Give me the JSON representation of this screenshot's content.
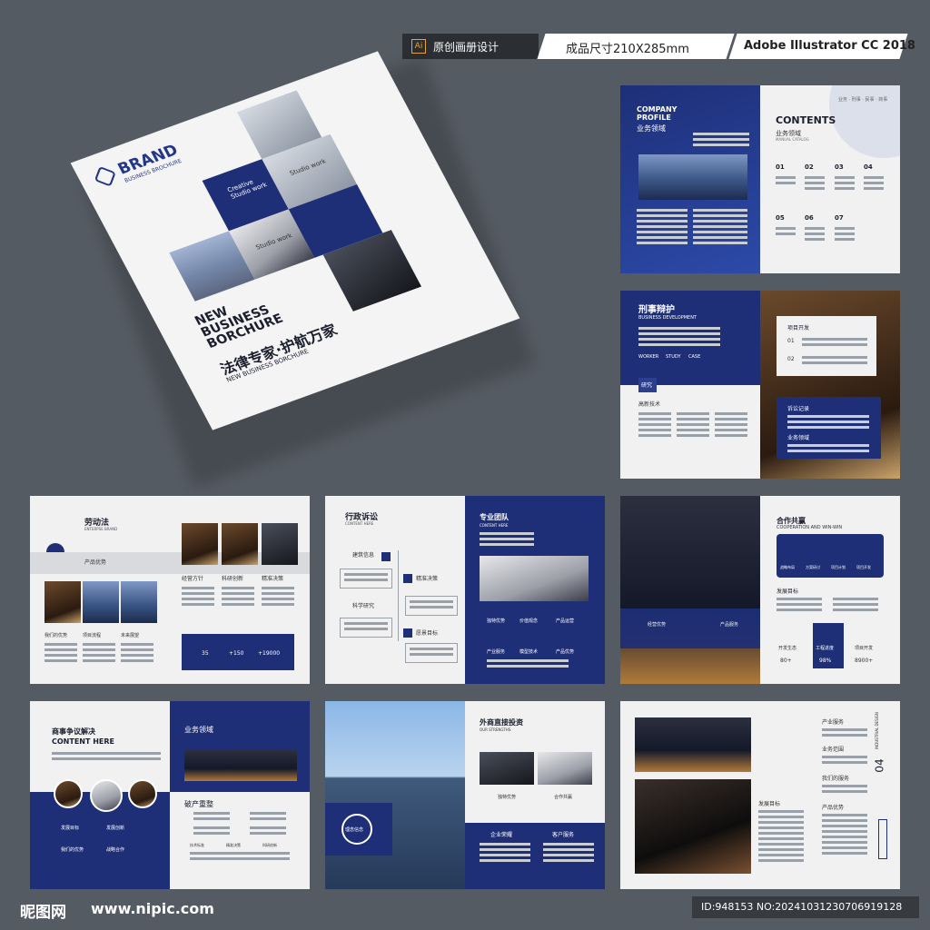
{
  "top_bar": {
    "ai_badge": "Ai",
    "design_label": "原创画册设计",
    "size_label": "成品尺寸210X285mm",
    "software_label": "Adobe Illustrator CC 2018"
  },
  "cover": {
    "brand": "BRAND",
    "brand_sub": "BUSINESS BROCHURE",
    "tile1_title": "Creative Studio work",
    "tile2_title": "Studio work",
    "tile3_title": "Studio work",
    "headline_en": "NEW\nBUSINESS\nBORCHURE",
    "headline_cn": "法律专家·护航万家",
    "headline_sub": "NEW BUSINESS BORCHURE"
  },
  "page_contents": {
    "company_profile": "COMPANY\nPROFILE",
    "profile_cn": "业务领域",
    "contents": "CONTENTS",
    "contents_sub": "业务领域",
    "manual_catalog": "MANUAL CATALOG",
    "nums": [
      "01",
      "02",
      "03",
      "04",
      "05",
      "06",
      "07"
    ],
    "corner_text": "业务 · 刑事 · 民事 · 商事"
  },
  "page_criminal": {
    "title": "刑事辩护",
    "subtitle": "BUSINESS DEVELOPMENT",
    "tabs": [
      "WORKER",
      "STUDY",
      "CASE"
    ],
    "research": "研究",
    "skill": "高新技术",
    "project": "项目开发",
    "n1": "01",
    "n2": "02",
    "record": "诉讼记录",
    "field": "业务领域"
  },
  "page_labor": {
    "title": "劳动法",
    "subtitle": "ENTERPSE BRAND",
    "product": "产品优势",
    "c1": "经营方针",
    "c2": "科研创新",
    "c3": "精准决策",
    "b1": "我们的优势",
    "b2": "项目流程",
    "b3": "未来展望",
    "s1": "35",
    "s2": "+150",
    "s3": "+19000"
  },
  "page_admin": {
    "title": "行政诉讼",
    "subtitle": "CONTENT HERE",
    "t1": "建筑信息",
    "t2": "科学研究",
    "t3": "精准决策",
    "t4": "愿景目标",
    "team": "专业团队",
    "team_sub": "CONTENT HERE",
    "i1": "独特优势",
    "i2": "价值观念",
    "i3": "产品运营",
    "i4": "产业服务",
    "i5": "模型技术",
    "i6": "产品优势"
  },
  "page_coop": {
    "title": "合作共赢",
    "subtitle": "COOPERATION AND WIN-WIN",
    "h1": "战略布局",
    "h2": "方案研讨",
    "h3": "项目计划",
    "h4": "项目开发",
    "goal": "发展目标",
    "n1": "经营优势",
    "n2": "产品服务",
    "s1": "开发生态",
    "s2": "工程进度",
    "s3": "项目开发",
    "v1": "80+",
    "v2": "98%",
    "v3": "8900+"
  },
  "page_commercial": {
    "title": "商事争议解决",
    "subtitle": "CONTENT HERE",
    "field": "业务领域",
    "bankruptcy": "破产重整",
    "g1": "发展目标",
    "g2": "发展创新",
    "g3": "我们的优势",
    "g4": "战略合作",
    "q1": "技术标准",
    "q2": "精准决策",
    "q3": "科研创新"
  },
  "page_foreign": {
    "title": "外商直接投资",
    "subtitle": "OUR STRENGTHS",
    "c1": "独特优势",
    "c2": "合作共赢",
    "circle": "理念信念",
    "b1": "企业荣耀",
    "b2": "客户服务"
  },
  "page_last": {
    "l1": "产业服务",
    "l2": "业务范围",
    "l3": "我们的服务",
    "l4": "产品优势",
    "goal": "发展目标",
    "side_num": "04",
    "side_text": "INDUSTRIAL DESIGN"
  },
  "footer": {
    "logo": "昵图网",
    "url": "www.nipic.com",
    "id_text": "ID:948153 NO:20241031230706919128"
  }
}
